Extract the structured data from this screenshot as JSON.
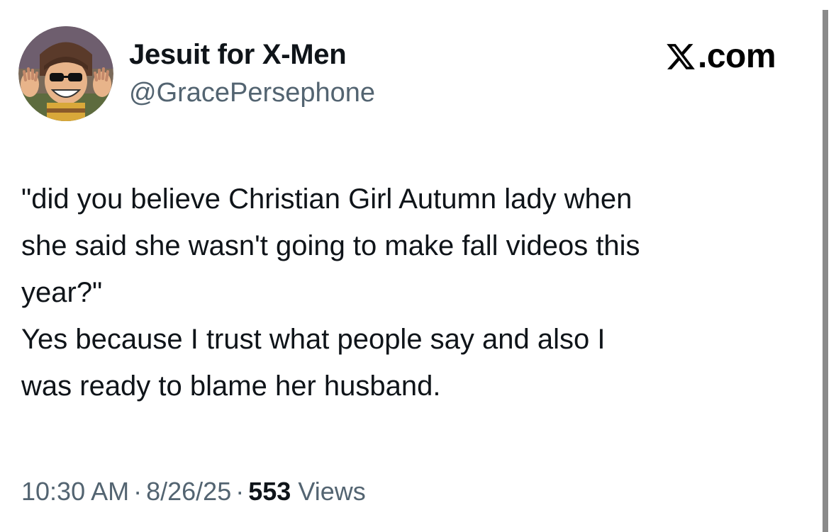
{
  "author": {
    "display_name": "Jesuit for X-Men",
    "handle": "@GracePersephone",
    "avatar_icon": "cartoon-avatar"
  },
  "brand": {
    "icon": "x-logo-icon",
    "text": ".com"
  },
  "tweet": {
    "lines": [
      "\"did you believe Christian Girl Autumn lady when",
      "she said she wasn't going to make fall videos this",
      "year?\"",
      "Yes because I trust what people say and also I",
      "was ready to blame her husband."
    ]
  },
  "meta": {
    "time": "10:30 AM",
    "date": "8/26/25",
    "views_count": "553",
    "views_label": "Views",
    "separator": "·"
  },
  "colors": {
    "text": "#0f1419",
    "secondary": "#536471",
    "background": "#ffffff"
  }
}
